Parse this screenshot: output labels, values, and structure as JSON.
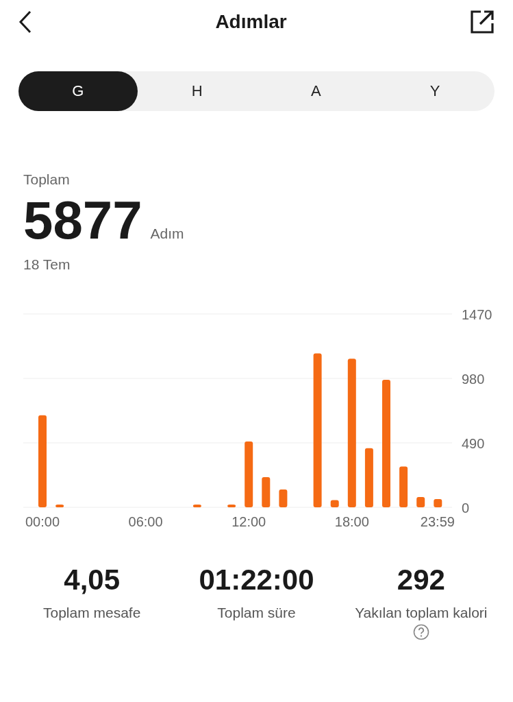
{
  "header": {
    "title": "Adımlar"
  },
  "tabs": [
    {
      "label": "G",
      "selected": true
    },
    {
      "label": "H",
      "selected": false
    },
    {
      "label": "A",
      "selected": false
    },
    {
      "label": "Y",
      "selected": false
    }
  ],
  "summary": {
    "label": "Toplam",
    "value": "5877",
    "unit": "Adım",
    "date": "18 Tem"
  },
  "chart_data": {
    "type": "bar",
    "x": [
      0,
      1,
      9,
      11,
      12,
      13,
      14,
      16,
      17,
      18,
      19,
      20,
      21,
      22,
      23
    ],
    "xlim": [
      0,
      23.98
    ],
    "series": [
      {
        "color": "#f56a14",
        "values": [
          700,
          20,
          20,
          20,
          500,
          230,
          135,
          1170,
          55,
          1130,
          450,
          970,
          310,
          78,
          63
        ]
      }
    ],
    "ylim": [
      0,
      1470
    ],
    "yticks": [
      0,
      490,
      980,
      1470
    ],
    "xticks": [
      {
        "value": 0,
        "label": "00:00"
      },
      {
        "value": 6,
        "label": "06:00"
      },
      {
        "value": 12,
        "label": "12:00"
      },
      {
        "value": 18,
        "label": "18:00"
      },
      {
        "value": 23.98,
        "label": "23:59"
      }
    ]
  },
  "stats": [
    {
      "value": "4,05",
      "label": "Toplam mesafe",
      "help": false
    },
    {
      "value": "01:22:00",
      "label": "Toplam süre",
      "help": false
    },
    {
      "value": "292",
      "label": "Yakılan toplam kalori",
      "help": true
    }
  ]
}
